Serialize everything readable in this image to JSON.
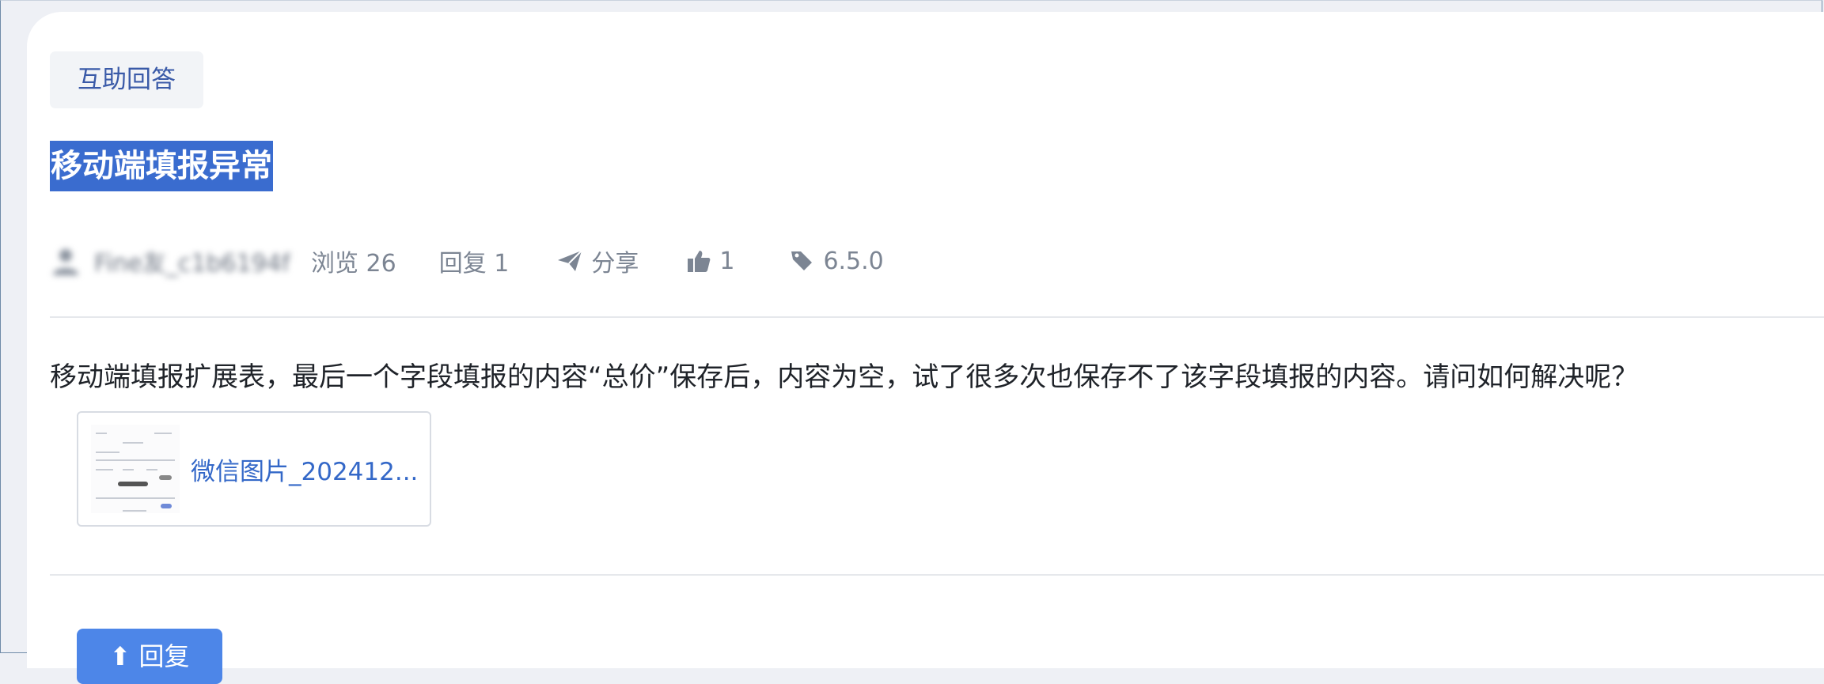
{
  "tag": "互助回答",
  "title": "移动端填报异常",
  "meta": {
    "author": "Fine友_c1b6194f",
    "views_label": "浏览 26",
    "replies_label": "回复 1",
    "share_label": "分享",
    "likes_count": "1",
    "version": "6.5.0"
  },
  "body": "移动端填报扩展表，最后一个字段填报的内容“总价”保存后，内容为空，试了很多次也保存不了该字段填报的内容。请问如何解决呢？",
  "attachment": {
    "name": "微信图片_202412..."
  },
  "actions": {
    "reply_label": "回复"
  },
  "colors": {
    "accent": "#4d86e8",
    "title_highlight": "#3a6ccf",
    "tag_text": "#3a5aa8",
    "link": "#3468c8"
  },
  "icons": [
    "user-icon",
    "send-icon",
    "thumbs-up-icon",
    "tag-icon",
    "reply-arrow-icon"
  ]
}
